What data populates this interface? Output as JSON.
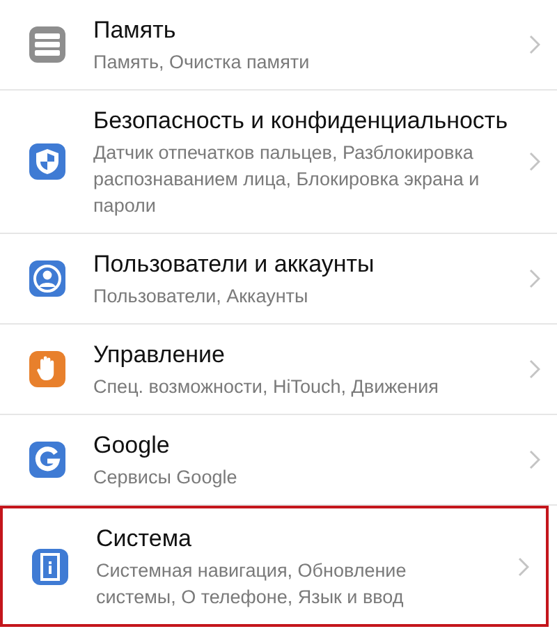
{
  "items": [
    {
      "kind": "storage",
      "color": "#8e8e8e",
      "title": "Память",
      "subtitle": "Память, Очистка памяти",
      "highlighted": false
    },
    {
      "kind": "shield",
      "color": "#3f7bd4",
      "title": "Безопасность и конфиденциальность",
      "subtitle": "Датчик отпечатков пальцев, Разблокировка распознаванием лица, Блокировка экрана и пароли",
      "highlighted": false
    },
    {
      "kind": "user",
      "color": "#3f7bd4",
      "title": "Пользователи и аккаунты",
      "subtitle": "Пользователи, Аккаунты",
      "highlighted": false
    },
    {
      "kind": "hand",
      "color": "#e8802c",
      "title": "Управление",
      "subtitle": "Спец. возможности, HiTouch, Движения",
      "highlighted": false
    },
    {
      "kind": "google",
      "color": "#3f7bd4",
      "title": "Google",
      "subtitle": "Сервисы Google",
      "highlighted": false
    },
    {
      "kind": "system",
      "color": "#3f7bd4",
      "title": "Система",
      "subtitle": "Системная навигация, Обновление системы, О телефоне, Язык и ввод",
      "highlighted": true
    }
  ]
}
